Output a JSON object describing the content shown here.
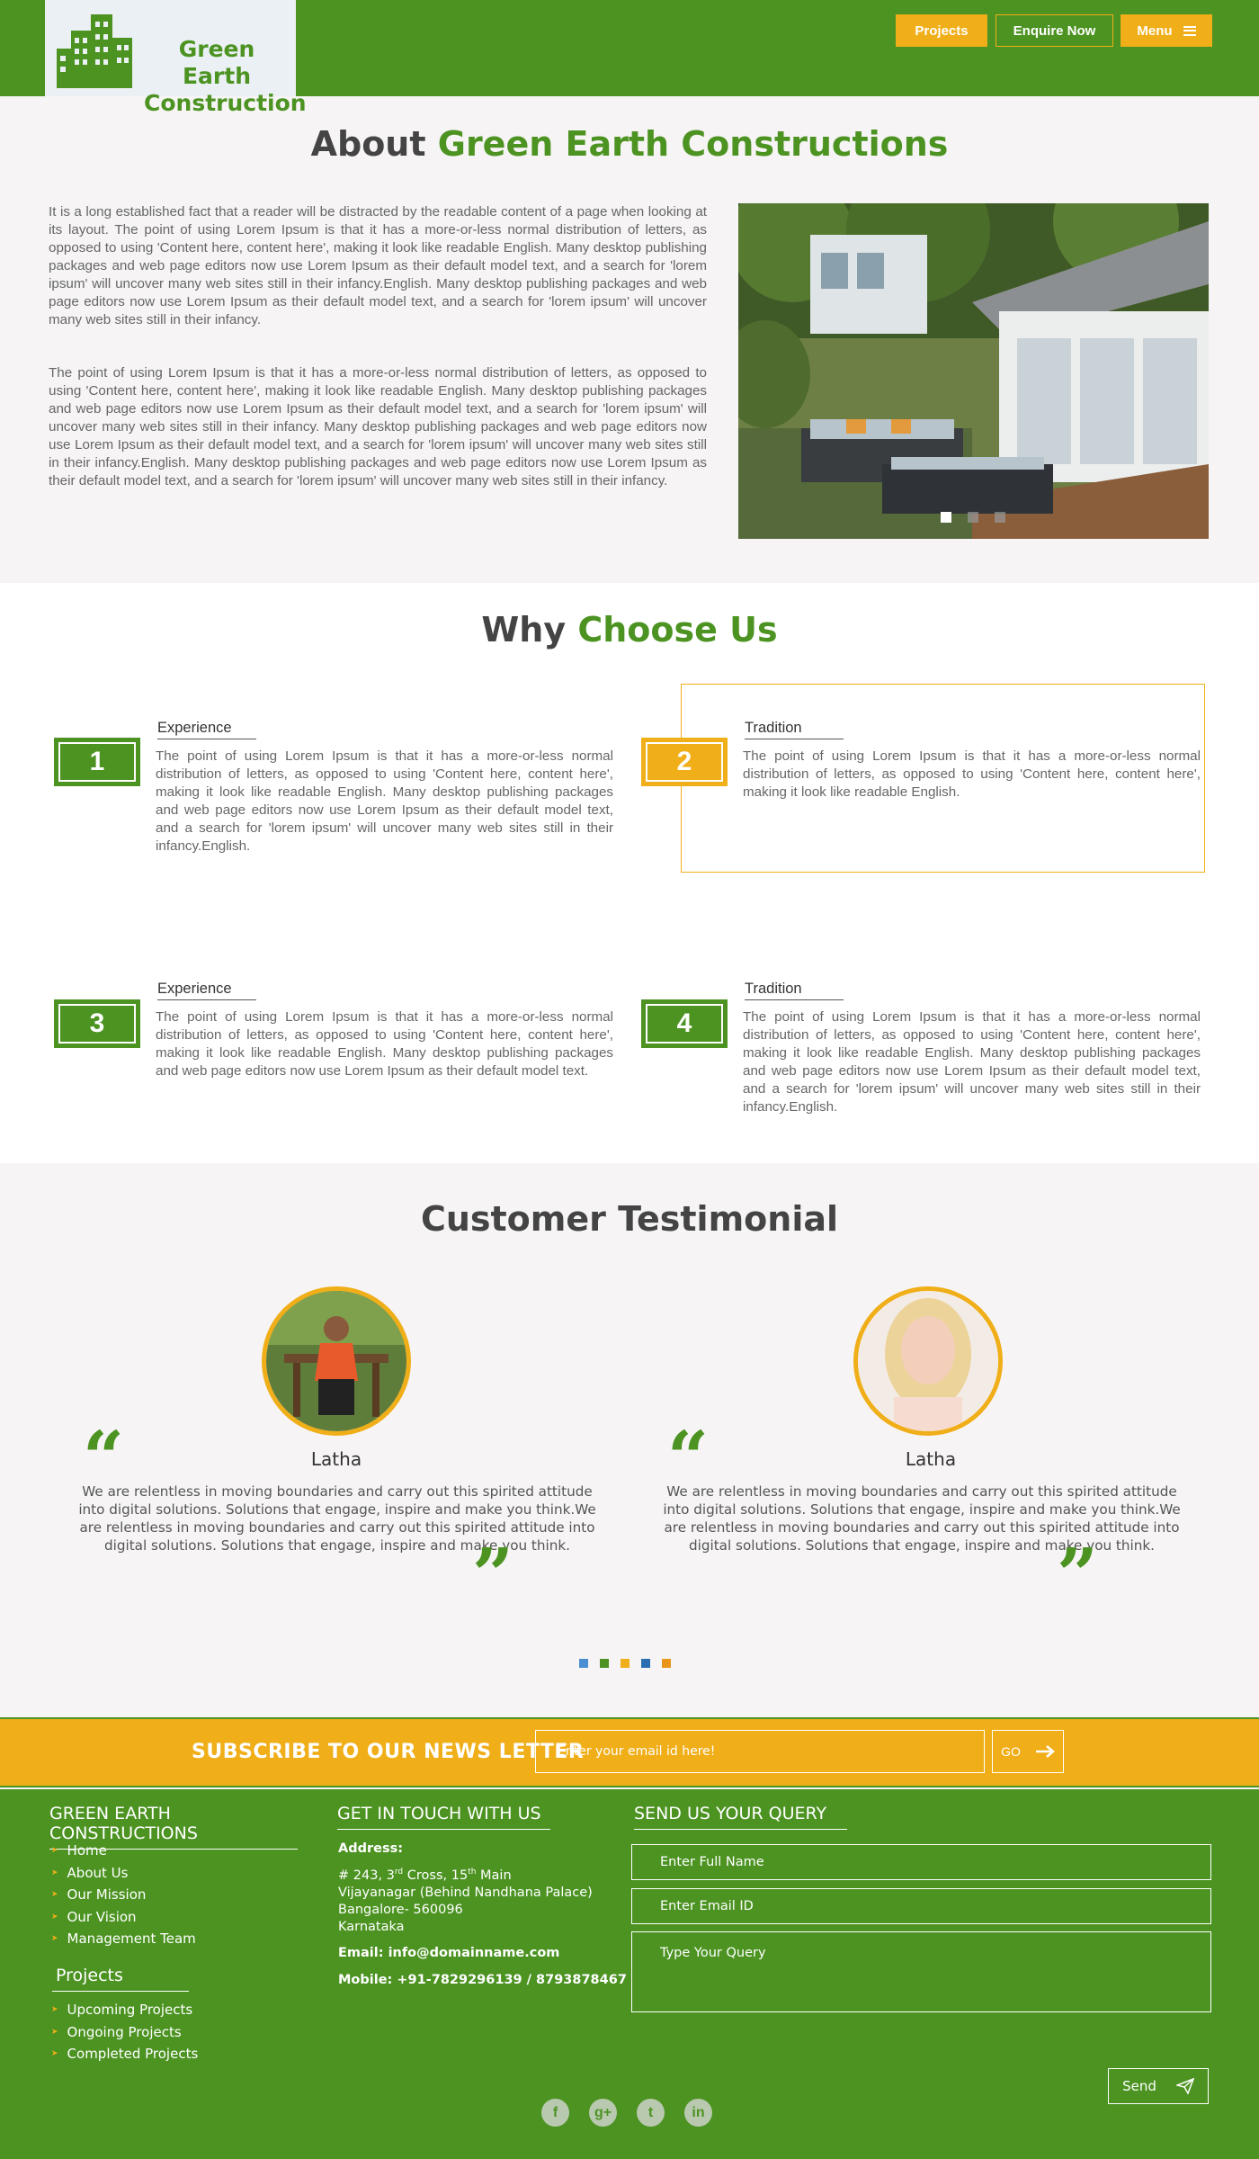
{
  "header": {
    "logo_line1": "Green Earth",
    "logo_line2": "Construction",
    "nav": {
      "projects": "Projects",
      "enquire": "Enquire Now",
      "menu": "Menu"
    }
  },
  "about": {
    "title_plain": "About ",
    "title_accent": "Green Earth Constructions",
    "p1": "It is a long established fact that a reader will be distracted by the readable content of a page when looking at its layout. The point of using Lorem Ipsum is that it has a more-or-less normal distribution of letters, as opposed to using 'Content here, content here', making it look like readable English. Many desktop publishing packages and web page editors now use Lorem Ipsum as their default model text, and a search for 'lorem ipsum' will uncover many web sites still in their infancy.English. Many desktop publishing packages and web page editors now use Lorem Ipsum as their default model text, and a search for 'lorem ipsum' will uncover many web sites still in their infancy.",
    "p2": "The point of using Lorem Ipsum is that it has a more-or-less normal distribution of letters, as opposed to using 'Content here, content here', making it look like readable English. Many desktop publishing packages and web page editors now use Lorem Ipsum as their default model text, and a search for 'lorem ipsum' will uncover many web sites still in their infancy. Many desktop publishing packages and web page editors now use Lorem Ipsum as their default model text, and a search for 'lorem ipsum' will uncover many web sites still in their infancy.English. Many desktop publishing packages and web page editors now use Lorem Ipsum as their default model text, and a search for 'lorem ipsum' will uncover many web sites still in their infancy."
  },
  "why": {
    "title_plain": "Why ",
    "title_accent": "Choose Us",
    "features": [
      {
        "num": "1",
        "title": "Experience",
        "text": "The point of using Lorem Ipsum is that it has a more-or-less normal distribution of letters, as opposed to using 'Content here, content here', making it look like readable English. Many desktop publishing packages and web page editors now use Lorem Ipsum as their default model text, and a search for 'lorem ipsum' will uncover many web sites still in their infancy.English."
      },
      {
        "num": "2",
        "title": "Tradition",
        "text": "The point of using Lorem Ipsum is that it has a more-or-less normal distribution of letters, as opposed to using 'Content here, content here', making it look like readable English."
      },
      {
        "num": "3",
        "title": "Experience",
        "text": "The point of using Lorem Ipsum is that it has a more-or-less normal distribution of letters, as opposed to using 'Content here, content here', making it look like readable English.  Many desktop publishing packages and web page editors now use Lorem Ipsum as their default model text."
      },
      {
        "num": "4",
        "title": "Tradition",
        "text": "The point of using Lorem Ipsum is that it has a more-or-less normal distribution of letters, as opposed to using 'Content here, content here', making it look like readable English.  Many desktop publishing packages and web page editors now use Lorem Ipsum as their default model text, and a search for 'lorem ipsum' will uncover many web sites still in their infancy.English."
      }
    ]
  },
  "testimonial": {
    "title": "Customer Testimonial",
    "items": [
      {
        "name": "Latha",
        "text": "We are relentless in moving boundaries and carry out this spirited attitude into digital solutions. Solutions that engage, inspire and make you think.We are relentless in moving boundaries and carry out this spirited attitude into digital solutions. Solutions that engage, inspire and make you think."
      },
      {
        "name": "Latha",
        "text": "We are relentless in moving boundaries and carry out this spirited attitude into digital solutions. Solutions that engage, inspire and make you think.We are relentless in moving boundaries and carry out this spirited attitude into digital solutions. Solutions that engage, inspire and make you think."
      }
    ],
    "pager_colors": [
      "#4a8fd4",
      "#4c9322",
      "#f0ae18",
      "#2a6db0",
      "#e8951a"
    ]
  },
  "newsletter": {
    "label": "SUBSCRIBE TO OUR NEWS LETTER",
    "placeholder": "Enter your email id here!",
    "go": "GO"
  },
  "footer": {
    "col1_head": "GREEN EARTH CONSTRUCTIONS",
    "links": [
      "Home",
      "About Us",
      "Our Mission",
      "Our Vision",
      "Management Team"
    ],
    "projects_head": "Projects",
    "projects": [
      "Upcoming Projects",
      "Ongoing Projects",
      "Completed Projects"
    ],
    "col2_head": "GET IN TOUCH WITH US",
    "address_label": "Address:",
    "address_line1_a": "# 243, 3",
    "address_line1_sup1": "rd",
    "address_line1_b": " Cross, 15",
    "address_line1_sup2": "th",
    "address_line1_c": " Main",
    "address_line2": "Vijayanagar (Behind Nandhana Palace)",
    "address_line3": "Bangalore- 560096",
    "address_line4": "Karnataka",
    "email": "Email: info@domainname.com",
    "mobile": "Mobile: +91-7829296139 / 8793878467",
    "col3_head": "SEND US YOUR QUERY",
    "name_placeholder": "Enter Full Name",
    "email_placeholder": "Enter Email ID",
    "query_placeholder": "Type Your Query",
    "send": "Send",
    "social": [
      "f",
      "g+",
      "t",
      "in"
    ]
  },
  "colors": {
    "brand_green": "#4c9322",
    "accent_yellow": "#f0ae18"
  }
}
